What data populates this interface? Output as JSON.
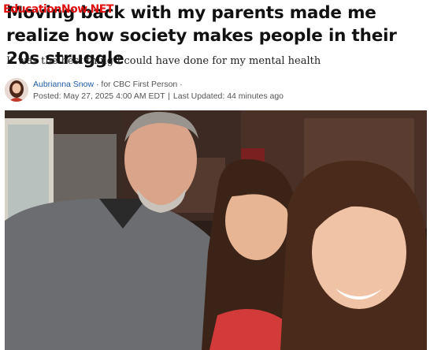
{
  "watermark": "EducationNow.NET",
  "article": {
    "headline": "Moving back with my parents made me realize how society makes people in their 20s struggle",
    "dek": "It was the best thing I could have done for my mental health",
    "author": "Aubrianna Snow",
    "author_source": "for CBC First Person",
    "posted": "Posted: May 27, 2025 4:00 AM EDT",
    "updated": "Last Updated: 44 minutes ago"
  },
  "icons": {
    "author_avatar": "author-photo",
    "hero": "family-selfie-photo"
  }
}
